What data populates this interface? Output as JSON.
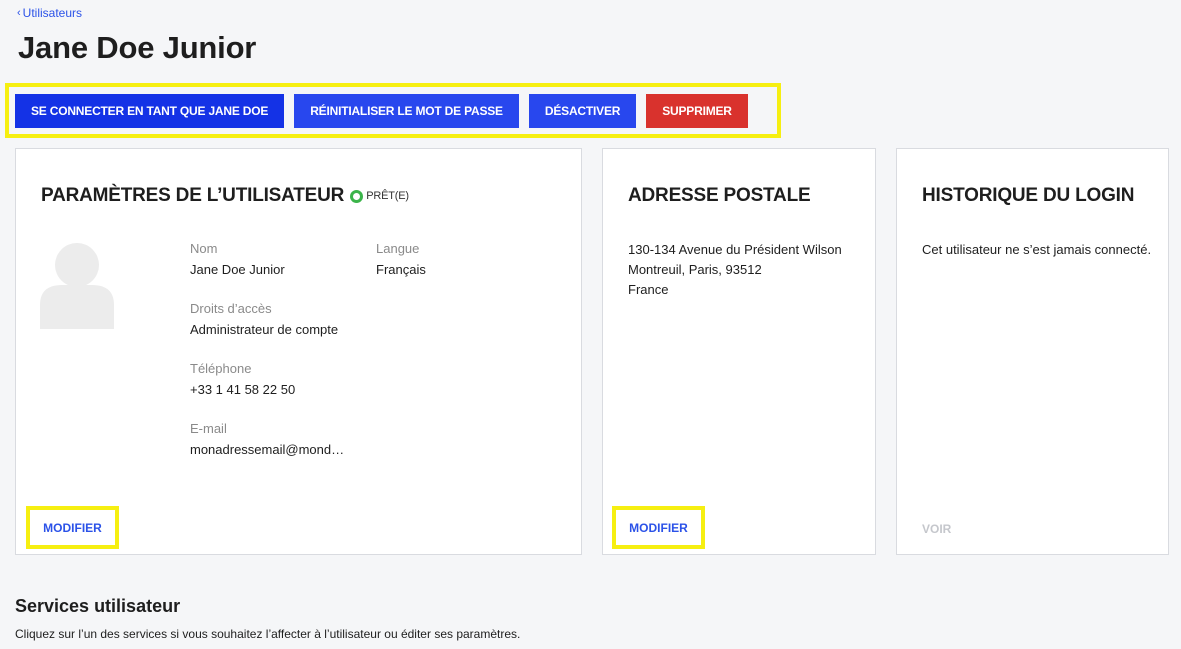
{
  "breadcrumb": {
    "label": "Utilisateurs"
  },
  "page": {
    "title": "Jane Doe Junior"
  },
  "actions": {
    "login_as": "SE CONNECTER EN TANT QUE JANE DOE",
    "reset_password": "RÉINITIALISER LE MOT DE PASSE",
    "deactivate": "DÉSACTIVER",
    "delete": "SUPPRIMER"
  },
  "user_settings": {
    "title": "PARAMÈTRES DE L’UTILISATEUR",
    "status": "PRÊT(E)",
    "name_label": "Nom",
    "name_value": "Jane Doe Junior",
    "language_label": "Langue",
    "language_value": "Français",
    "rights_label": "Droits d’accès",
    "rights_value": "Administrateur de compte",
    "phone_label": "Téléphone",
    "phone_value": "+33 1 41 58 22 50",
    "email_label": "E-mail",
    "email_value": "monadressemail@mond…",
    "edit_label": "MODIFIER"
  },
  "postal_address": {
    "title": "ADRESSE POSTALE",
    "line1": "130-134 Avenue du Président Wilson",
    "line2": "Montreuil, Paris, 93512",
    "line3": "France",
    "edit_label": "MODIFIER"
  },
  "login_history": {
    "title": "HISTORIQUE DU LOGIN",
    "empty_text": "Cet utilisateur ne s’est jamais connecté.",
    "view_label": "VOIR"
  },
  "services": {
    "title": "Services utilisateur",
    "description": "Cliquez sur l’un des services si vous souhaitez l’affecter à l’utilisateur ou éditer ses paramètres."
  },
  "colors": {
    "primary_blue": "#1432e6",
    "danger_red": "#d9322d",
    "link_blue": "#2b52e8",
    "status_green": "#3bb44a",
    "highlight_yellow": "#f6ef11"
  }
}
